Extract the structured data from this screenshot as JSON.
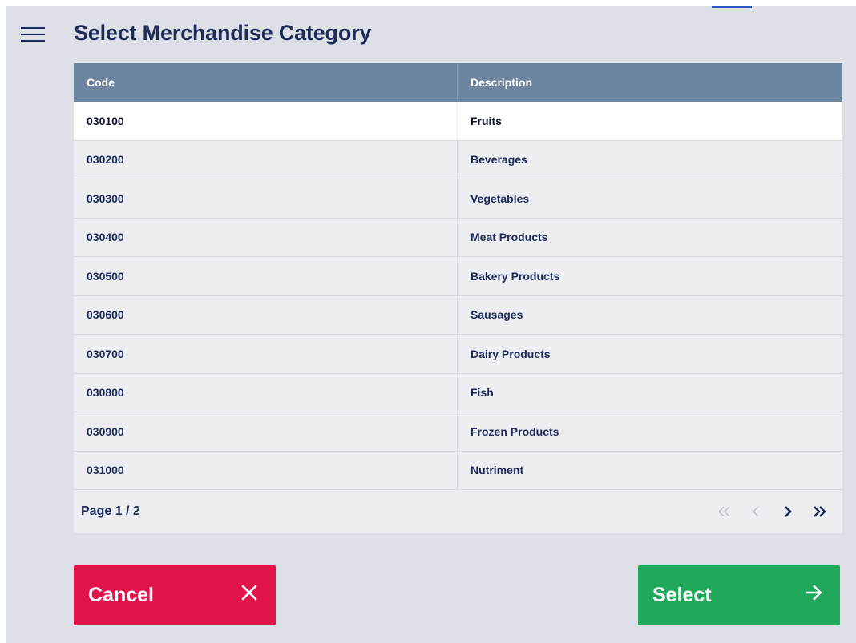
{
  "header": {
    "title": "Select Merchandise Category"
  },
  "table": {
    "columns": [
      "Code",
      "Description"
    ],
    "rows": [
      {
        "code": "030100",
        "description": "Fruits"
      },
      {
        "code": "030200",
        "description": "Beverages"
      },
      {
        "code": "030300",
        "description": "Vegetables"
      },
      {
        "code": "030400",
        "description": "Meat Products"
      },
      {
        "code": "030500",
        "description": "Bakery Products"
      },
      {
        "code": "030600",
        "description": "Sausages"
      },
      {
        "code": "030700",
        "description": "Dairy Products"
      },
      {
        "code": "030800",
        "description": "Fish"
      },
      {
        "code": "030900",
        "description": "Frozen Products"
      },
      {
        "code": "031000",
        "description": "Nutriment"
      }
    ],
    "selected_index": 0
  },
  "pager": {
    "label": "Page 1 / 2",
    "icons": [
      "first-page-icon",
      "previous-page-icon",
      "next-page-icon",
      "last-page-icon"
    ]
  },
  "actions": {
    "cancel_label": "Cancel",
    "cancel_icon": "close-icon",
    "select_label": "Select",
    "select_icon": "arrow-right-icon"
  },
  "colors": {
    "header_row": "#6d859e",
    "cancel": "#e0144a",
    "select": "#20a95a",
    "title": "#1e2a5a"
  }
}
